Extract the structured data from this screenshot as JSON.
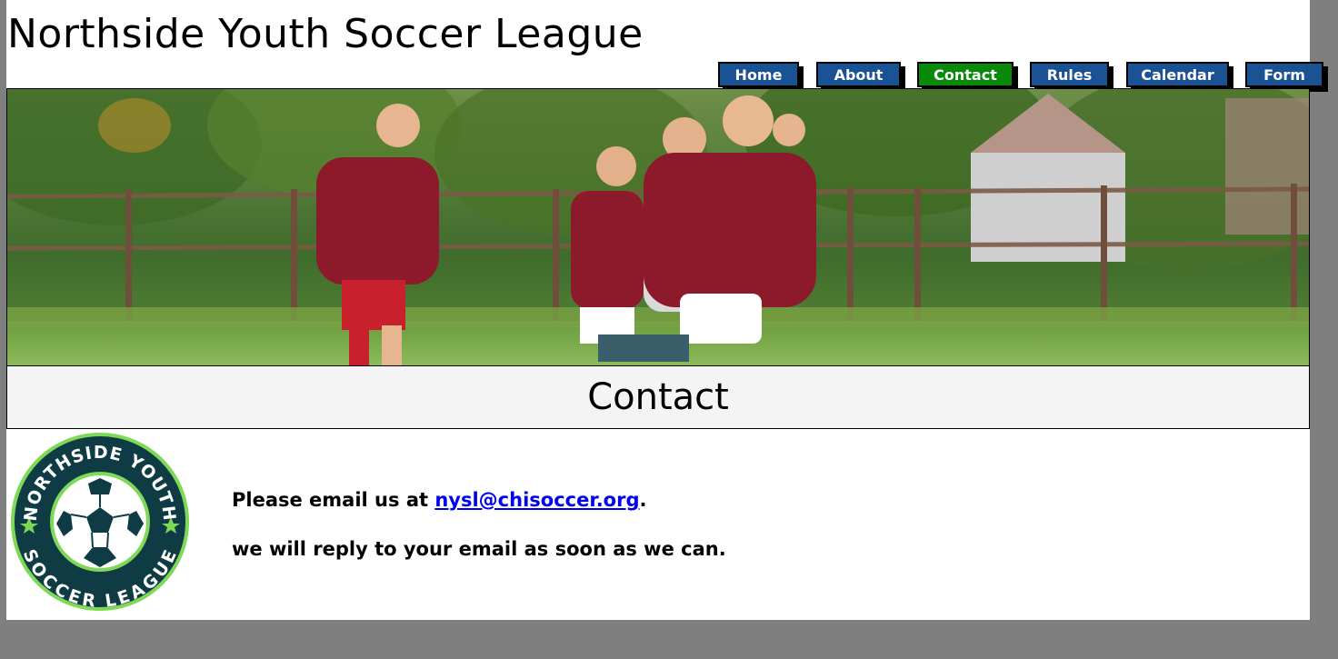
{
  "site": {
    "title": "Northside Youth Soccer League"
  },
  "nav": {
    "items": [
      {
        "label": "Home",
        "active": false
      },
      {
        "label": "About",
        "active": false
      },
      {
        "label": "Contact",
        "active": true
      },
      {
        "label": "Rules",
        "active": false
      },
      {
        "label": "Calendar",
        "active": false
      },
      {
        "label": "Form",
        "active": false
      }
    ]
  },
  "hero": {
    "image_name": "kids-playing-soccer-photo"
  },
  "page": {
    "heading": "Contact"
  },
  "logo": {
    "icon": "soccer-ball-icon",
    "top_text": "NORTHSIDE YOUTH",
    "bottom_text": "SOCCER LEAGUE"
  },
  "contact": {
    "line1_prefix": "Please email us at ",
    "email": "nysl@chisoccer.org",
    "line1_suffix": ".",
    "line2": "we will reply to your email as soon as we can."
  },
  "colors": {
    "nav_button": "#1a5294",
    "nav_active": "#0a8a0a",
    "logo_dark": "#0f3b45",
    "logo_ring": "#7ed957",
    "link": "#0000ee",
    "background": "#7f7f7f"
  }
}
